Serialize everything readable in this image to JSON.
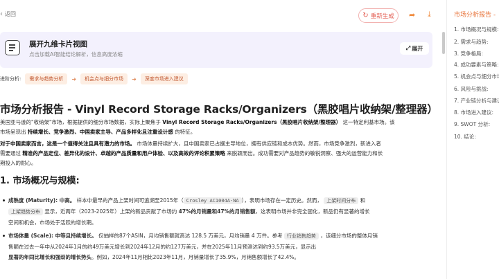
{
  "topbar": {
    "back_label": "返回",
    "regenerate_label": "重新生成"
  },
  "card": {
    "title": "展开九维卡片视图",
    "subtitle": "点击加载AI智能结论解析，信息高度浓缩",
    "expand_label": "展开"
  },
  "analysis": {
    "label": "进阶分析:",
    "chips": [
      "需求与趋势分析",
      "机会点与细分市场",
      "深度市场进入建议"
    ]
  },
  "article": {
    "title": "市场分析报告 - Vinyl Record Storage Racks/Organizers（黑胶唱片收纳架/整理器）",
    "intro_1": "美国亚马逊的\"收纳架\"市场，根据提供的细分市场数据，实际上聚焦于 ",
    "intro_1_bold": "Vinyl Record Storage Racks/Organizers（黑胶唱片收纳架/整理器）",
    "intro_1_tail": " 这一特定利基市场。该",
    "intro_2_a": "市场呈现出 ",
    "intro_2_b": "持续增长、竞争激烈、中国卖家主导、产品多样化且注重设计感",
    "intro_2_c": " 的特征。",
    "para2_l1_bold": "对于中国卖家而言，这是一个值得关注且具有潜力的市场。",
    "para2_l1_tail": " 市场体量持续扩大，且中国卖家已占据主导地位，拥有供应链和成本优势。然而，市场竞争激烈，新进入者",
    "para2_l2_a": "需要通过 ",
    "para2_l2_b": "精准的产品定位、差异化的设计、卓越的产品质量和用户体验、以及高效的评论积累策略",
    "para2_l2_c": " 来脱颖而出。成功需要对产品趋势的敏锐洞察、强大的运营能力和长",
    "para2_l3": "期投入的耐心。",
    "section_1": "1. 市场概况与规模:",
    "maturity_head": "成熟度 (Maturity): 中高。",
    "maturity_l1_a": " 样本中最早的产品上架时间可追溯至2015年（",
    "maturity_tag1": "Crosley AC1004A-NA",
    "maturity_l1_b": "），表明市场存在一定历史。然而，",
    "maturity_tag2": "上架时间分布",
    "maturity_l1_c": " 和",
    "maturity_tag3": "上架趋势分布",
    "maturity_l2_a": " 显示，近两年（2023-2025年）上架的新品贡献了市场约 ",
    "maturity_l2_b": "47%的月销量和47%的月销售额",
    "maturity_l2_c": "，这表明市场并非完全固化，新品仍有显著的增长",
    "maturity_l3": "空间和机会，市场处于活跃的增长期。",
    "volume_head": "市场体量 (Scale): 中等且持续增长。",
    "volume_l1_a": " 仅抽样的87个ASIN，月均销售额就高达 128.5 万美元，月均销量 4 万件。参考 ",
    "volume_tag": "行业销售趋势",
    "volume_l1_b": " ，该细分市场的整体月销",
    "volume_l2": "售额在过去一年中从2024年1月的约49万美元增长到2024年12月的约127万美元，并在2025年11月预测达到约93.5万美元，显示出",
    "volume_l3_a": "显著的年同比增长和强劲的增长势头",
    "volume_l3_b": "。例如，2024年11月相比2023年11月，月销量增长了35.9%，月销售额增长了42.4%。"
  },
  "toc": {
    "title": "市场分析报告 -",
    "items": [
      "1. 市场概况与规模:",
      "2. 需求与趋势:",
      "3. 竞争格局:",
      "4. 成功要素与策略:",
      "5. 机会点与细分市场:",
      "6. 风险与挑战:",
      "7. 产业链分析与建议:",
      "8. 市场进入建议:",
      "9. SWOT 分析:",
      "10. 结论:"
    ]
  },
  "colors": {
    "accent_orange": "#e8743b",
    "regen_red": "#e35d52",
    "card_bg": "#f3f1fd",
    "chip_bg": "#fdeee3"
  }
}
